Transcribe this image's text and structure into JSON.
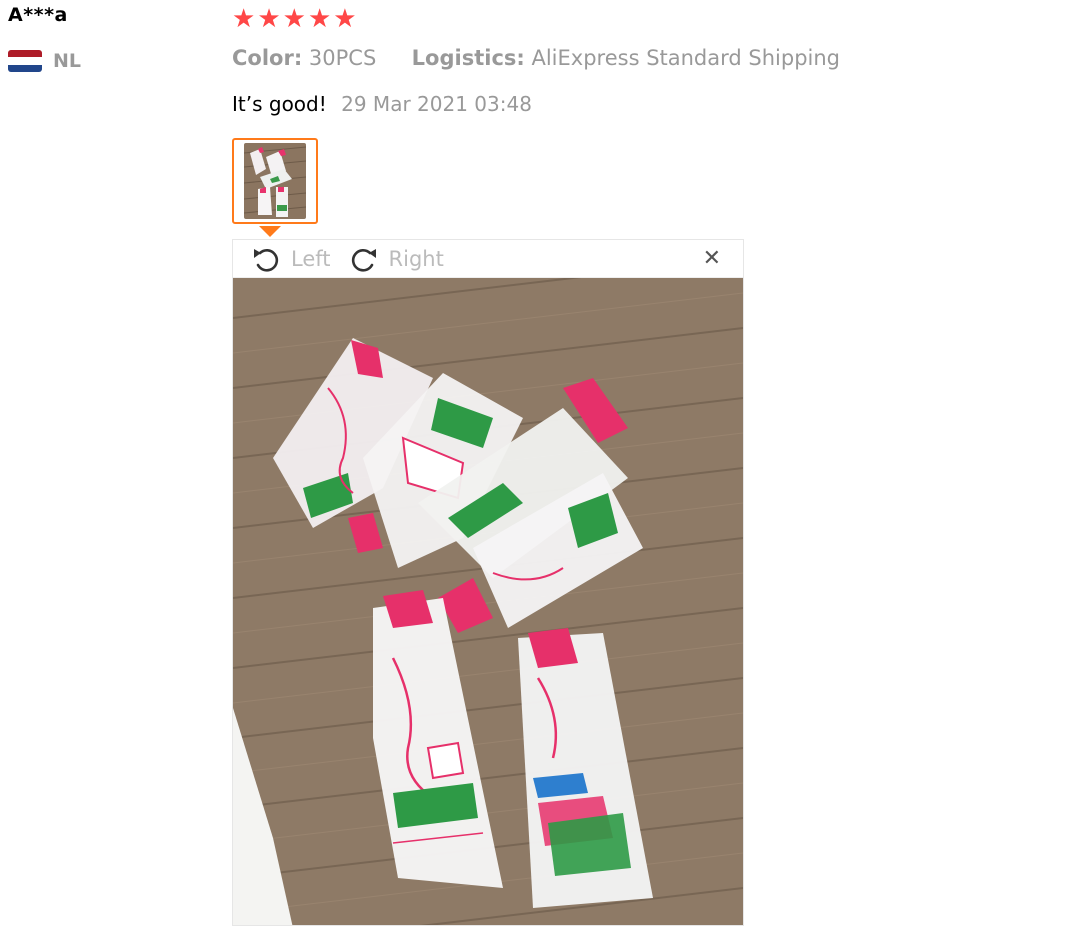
{
  "reviewer": {
    "name": "A***a",
    "country_code": "NL",
    "flag_colors": [
      "#ae1c28",
      "#ffffff",
      "#21468b"
    ]
  },
  "rating": {
    "stars": 5,
    "max": 5,
    "star_color": "#ff4747"
  },
  "specs": {
    "color_label": "Color:",
    "color_value": "30PCS",
    "logistics_label": "Logistics:",
    "logistics_value": "AliExpress Standard Shipping"
  },
  "feedback": {
    "text": "It’s good!",
    "date": "29 Mar 2021 03:48"
  },
  "photo_viewer": {
    "rotate_left_label": "Left",
    "rotate_right_label": "Right",
    "close_icon": "close-icon",
    "accent_color": "#ff7a1a"
  }
}
